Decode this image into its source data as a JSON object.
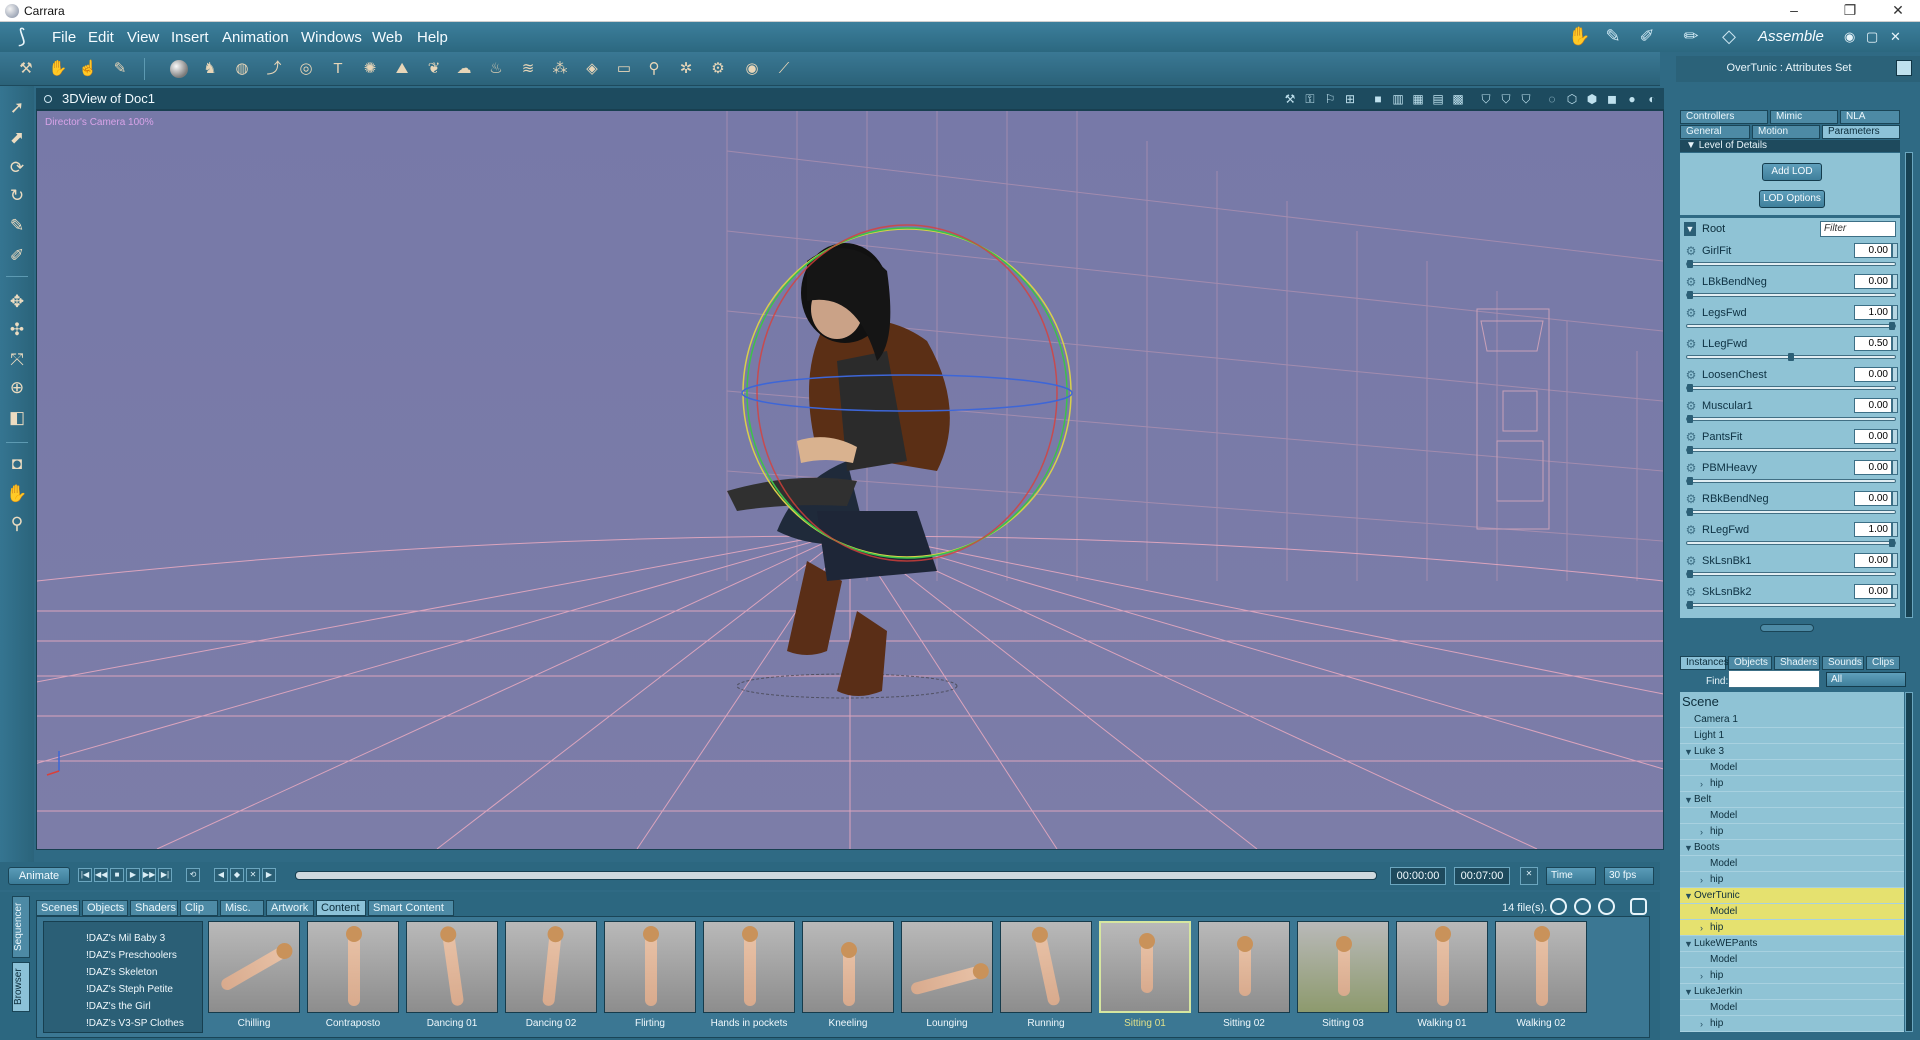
{
  "window": {
    "title": "Carrara"
  },
  "menu": {
    "items": [
      "File",
      "Edit",
      "View",
      "Insert",
      "Animation",
      "Windows",
      "Web",
      "Help"
    ],
    "room": "Assemble"
  },
  "view": {
    "title": "3DView of Doc1",
    "camera_label": "Director's Camera 100%"
  },
  "timeline": {
    "animate_label": "Animate",
    "current_time": "00:00:00",
    "end_time": "00:07:00",
    "time_mode": "Time",
    "fps": "30 fps"
  },
  "browser": {
    "side_tabs": [
      "Sequencer",
      "Browser"
    ],
    "tabs": [
      "Scenes",
      "Objects",
      "Shaders",
      "Clip",
      "Misc.",
      "Artwork",
      "Content",
      "Smart Content"
    ],
    "active_tab": "Content",
    "file_count": "14 file(s).",
    "tree_items": [
      "!DAZ's Mil Baby 3",
      "!DAZ's Preschoolers",
      "!DAZ's Skeleton",
      "!DAZ's Steph Petite",
      "!DAZ's the Girl",
      "!DAZ's V3-SP Clothes"
    ],
    "thumbnails": [
      "Chilling",
      "Contraposto",
      "Dancing 01",
      "Dancing 02",
      "Flirting",
      "Hands in pockets",
      "Kneeling",
      "Lounging",
      "Running",
      "Sitting 01",
      "Sitting 02",
      "Sitting 03",
      "Walking 01",
      "Walking 02"
    ],
    "selected_thumbnail": "Sitting 01"
  },
  "attributes": {
    "title": "OverTunic : Attributes Set",
    "tabs_row1": [
      "Controllers",
      "Mimic",
      "NLA"
    ],
    "tabs_row2": [
      "General",
      "Motion",
      "Parameters"
    ],
    "active_tab": "Parameters",
    "section": "Level of Details",
    "add_lod": "Add LOD",
    "lod_options": "LOD Options",
    "root_label": "Root",
    "filter_placeholder": "Filter",
    "params": [
      {
        "name": "GirlFit",
        "value": "0.00",
        "fraction": 0.0
      },
      {
        "name": "LBkBendNeg",
        "value": "0.00",
        "fraction": 0.0
      },
      {
        "name": "LegsFwd",
        "value": "1.00",
        "fraction": 1.0
      },
      {
        "name": "LLegFwd",
        "value": "0.50",
        "fraction": 0.5
      },
      {
        "name": "LoosenChest",
        "value": "0.00",
        "fraction": 0.0
      },
      {
        "name": "Muscular1",
        "value": "0.00",
        "fraction": 0.0
      },
      {
        "name": "PantsFit",
        "value": "0.00",
        "fraction": 0.0
      },
      {
        "name": "PBMHeavy",
        "value": "0.00",
        "fraction": 0.0
      },
      {
        "name": "RBkBendNeg",
        "value": "0.00",
        "fraction": 0.0
      },
      {
        "name": "RLegFwd",
        "value": "1.00",
        "fraction": 1.0
      },
      {
        "name": "SkLsnBk1",
        "value": "0.00",
        "fraction": 0.0
      },
      {
        "name": "SkLsnBk2",
        "value": "0.00",
        "fraction": 0.0
      }
    ]
  },
  "scene_panel": {
    "tabs": [
      "Instances",
      "Objects",
      "Shaders",
      "Sounds",
      "Clips"
    ],
    "active_tab": "Instances",
    "find_label": "Find:",
    "filter_value": "All",
    "title": "Scene",
    "items": [
      {
        "name": "Camera 1",
        "level": 0,
        "twist": "",
        "highlight": false
      },
      {
        "name": "Light 1",
        "level": 0,
        "twist": "",
        "highlight": false
      },
      {
        "name": "Luke 3",
        "level": 0,
        "twist": "▼",
        "highlight": false
      },
      {
        "name": "Model",
        "level": 1,
        "twist": "",
        "highlight": false
      },
      {
        "name": "hip",
        "level": 1,
        "twist": "›",
        "highlight": false
      },
      {
        "name": "Belt",
        "level": 0,
        "twist": "▼",
        "highlight": false
      },
      {
        "name": "Model",
        "level": 1,
        "twist": "",
        "highlight": false
      },
      {
        "name": "hip",
        "level": 1,
        "twist": "›",
        "highlight": false
      },
      {
        "name": "Boots",
        "level": 0,
        "twist": "▼",
        "highlight": false
      },
      {
        "name": "Model",
        "level": 1,
        "twist": "",
        "highlight": false
      },
      {
        "name": "hip",
        "level": 1,
        "twist": "›",
        "highlight": false
      },
      {
        "name": "OverTunic",
        "level": 0,
        "twist": "▼",
        "highlight": true
      },
      {
        "name": "Model",
        "level": 1,
        "twist": "",
        "highlight": true
      },
      {
        "name": "hip",
        "level": 1,
        "twist": "›",
        "highlight": true
      },
      {
        "name": "LukeWEPants",
        "level": 0,
        "twist": "▼",
        "highlight": false
      },
      {
        "name": "Model",
        "level": 1,
        "twist": "",
        "highlight": false
      },
      {
        "name": "hip",
        "level": 1,
        "twist": "›",
        "highlight": false
      },
      {
        "name": "LukeJerkin",
        "level": 0,
        "twist": "▼",
        "highlight": false
      },
      {
        "name": "Model",
        "level": 1,
        "twist": "",
        "highlight": false
      },
      {
        "name": "hip",
        "level": 1,
        "twist": "›",
        "highlight": false
      }
    ]
  },
  "colors": {
    "panel": "#2f6a84",
    "viewport": "#7a7ba9",
    "grid": "#e6a9c0",
    "selection": "#e5e16f"
  }
}
